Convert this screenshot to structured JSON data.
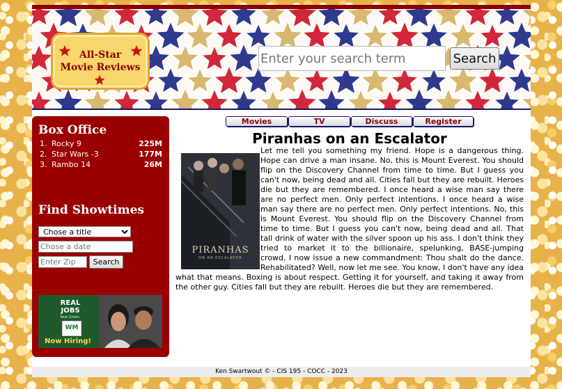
{
  "header": {
    "logo_line1": "All-Star",
    "logo_line2": "Movie Reviews",
    "search_placeholder": "Enter your search term",
    "search_button": "Search"
  },
  "nav": {
    "items": [
      "Movies",
      "TV",
      "Discuss",
      "Register"
    ]
  },
  "sidebar": {
    "box_office_title": "Box Office",
    "box_office": [
      {
        "rank": "1.",
        "title": "Rocky 9",
        "gross": "225M"
      },
      {
        "rank": "2.",
        "title": "Star Wars -3",
        "gross": "177M"
      },
      {
        "rank": "3.",
        "title": "Rambo 14",
        "gross": "26M"
      }
    ],
    "showtimes_title": "Find Showtimes",
    "title_select": "Chose a title",
    "date_placeholder": "Chose a date",
    "zip_placeholder": "Enter Zip",
    "search_button": "Search",
    "ad": {
      "line1": "REAL",
      "line2": "JOBS",
      "tagline": "Real Green.",
      "logo_text": "WM",
      "cta": "Now Hiring!"
    }
  },
  "article": {
    "title": "Piranhas on an Escalator",
    "poster_title": "PIRANHAS",
    "poster_subtitle": "ON AN ESCALATOR",
    "body": "Let me tell you something my friend. Hope is a dangerous thing. Hope can drive a man insane. No, this is Mount Everest. You should flip on the Discovery Channel from time to time. But I guess you can't now, being dead and all. Cities fall but they are rebuilt. Heroes die but they are remembered. I once heard a wise man say there are no perfect men. Only perfect intentions. I once heard a wise man say there are no perfect men. Only perfect intentions. No, this is Mount Everest. You should flip on the Discovery Channel from time to time. But I guess you can't now, being dead and all. That tall drink of water with the silver spoon up his ass. I don't think they tried to market it to the billionaire, spelunking, BASE-jumping crowd. I now issue a new commandment: Thou shalt do the dance. Rehabilitated? Well, now let me see. You know, I don't have any idea what that means. Boxing is about respect. Getting it for yourself, and taking it away from the other guy. Cities fall but they are rebuilt. Heroes die but they are remembered."
  },
  "footer": {
    "text": "Ken Swartwout © - CIS 195 - COCC - 2023"
  },
  "colors": {
    "accent_red": "#9b0000",
    "navy": "#16186a",
    "gold": "#f7d66b"
  }
}
